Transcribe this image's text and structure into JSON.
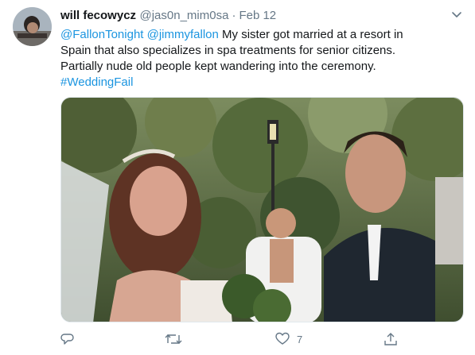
{
  "tweet": {
    "author_name": "will fecowycz",
    "handle": "@jas0n_mim0sa",
    "separator": "·",
    "date": "Feb 12",
    "mention_1": "@FallonTonight",
    "mention_2": "@jimmyfallon",
    "text_line_1": " My sister got married at a resort in",
    "text_line_2": "Spain that also specializes in spa treatments for senior citizens.",
    "text_line_3": "Partially nude old people kept wandering into the ceremony.",
    "hashtag": "#WeddingFail"
  },
  "actions": {
    "reply_count": "",
    "retweet_count": "",
    "like_count": "7"
  },
  "icons": {
    "caret": "chevron-down-icon",
    "reply": "reply-icon",
    "retweet": "retweet-icon",
    "like": "heart-icon",
    "share": "share-icon"
  },
  "colors": {
    "link": "#1b95e0",
    "text": "#14171a",
    "secondary": "#657786"
  }
}
